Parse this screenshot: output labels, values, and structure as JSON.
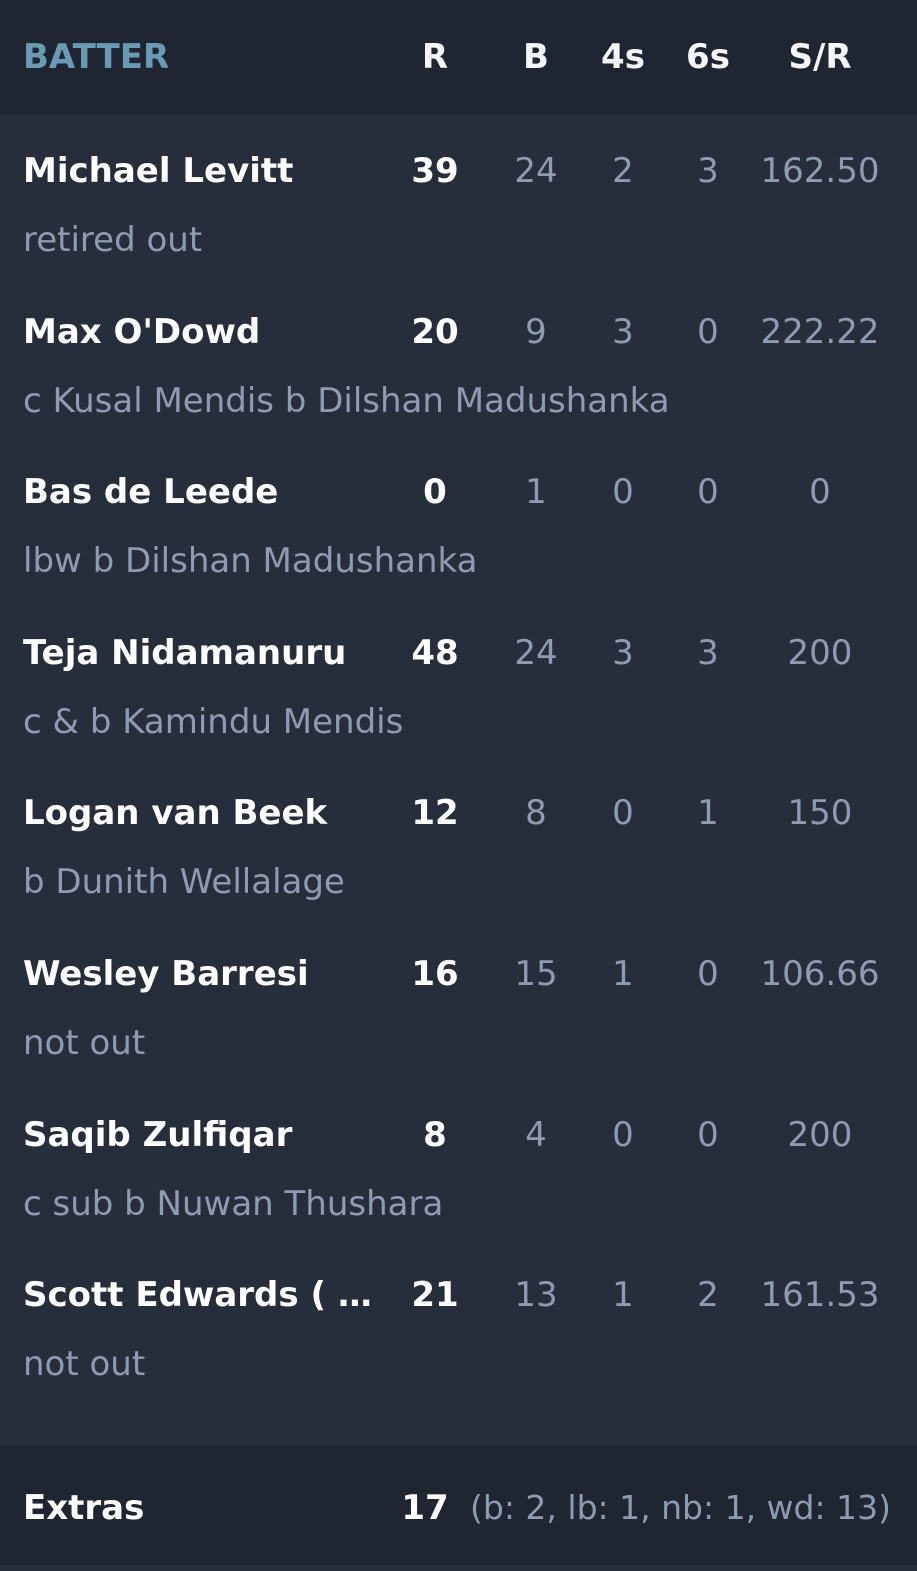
{
  "header": {
    "batter": "BATTER",
    "runs": "R",
    "balls": "B",
    "fours": "4s",
    "sixes": "6s",
    "strike_rate": "S/R"
  },
  "batters": [
    {
      "name": "Michael Levitt",
      "dismissal": "retired out",
      "runs": "39",
      "balls": "24",
      "fours": "2",
      "sixes": "3",
      "sr": "162.50"
    },
    {
      "name": "Max O'Dowd",
      "dismissal": "c Kusal Mendis b Dilshan Madushanka",
      "runs": "20",
      "balls": "9",
      "fours": "3",
      "sixes": "0",
      "sr": "222.22"
    },
    {
      "name": "Bas de Leede",
      "dismissal": "lbw b Dilshan Madushanka",
      "runs": "0",
      "balls": "1",
      "fours": "0",
      "sixes": "0",
      "sr": "0"
    },
    {
      "name": "Teja Nidamanuru",
      "dismissal": "c & b Kamindu Mendis",
      "runs": "48",
      "balls": "24",
      "fours": "3",
      "sixes": "3",
      "sr": "200"
    },
    {
      "name": "Logan van Beek",
      "dismissal": "b Dunith Wellalage",
      "runs": "12",
      "balls": "8",
      "fours": "0",
      "sixes": "1",
      "sr": "150"
    },
    {
      "name": "Wesley Barresi",
      "dismissal": "not out",
      "runs": "16",
      "balls": "15",
      "fours": "1",
      "sixes": "0",
      "sr": "106.66"
    },
    {
      "name": "Saqib Zulfiqar",
      "dismissal": "c sub b Nuwan Thushara",
      "runs": "8",
      "balls": "4",
      "fours": "0",
      "sixes": "0",
      "sr": "200"
    },
    {
      "name": "Scott Edwards ( c...",
      "dismissal": "not out",
      "runs": "21",
      "balls": "13",
      "fours": "1",
      "sixes": "2",
      "sr": "161.53"
    }
  ],
  "extras": {
    "label": "Extras",
    "total": "17",
    "detail": "(b: 2, lb: 1, nb: 1, wd: 13)"
  },
  "colors": {
    "background": "#272e3b",
    "header_bg": "#1f2531",
    "batter_header": "#6a9bb5",
    "primary_text": "#ffffff",
    "secondary_text": "#8f9bb0"
  }
}
